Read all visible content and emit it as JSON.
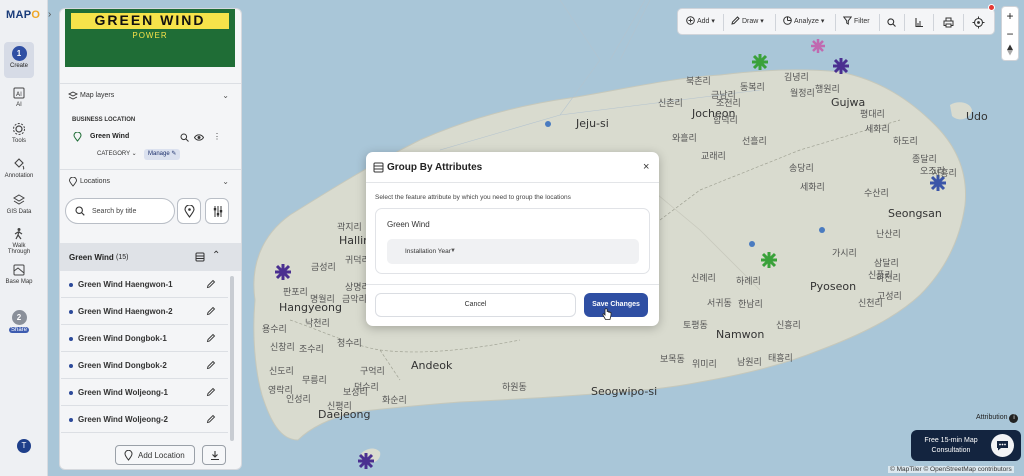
{
  "app": {
    "logo_text": "MAP",
    "logo_accent": "O"
  },
  "rail": {
    "toggle": "›",
    "create": {
      "number": "1",
      "label": "Create"
    },
    "items": [
      "AI",
      "Tools",
      "Annotation",
      "GIS Data",
      "Walk Through",
      "Base Map"
    ],
    "share": {
      "number": "2",
      "label": "Share"
    },
    "avatar": "T"
  },
  "brand": {
    "title": "GREEN WIND",
    "subtitle": "POWER"
  },
  "map_layers": {
    "title": "Map layers",
    "section_label": "BUSINESS LOCATION",
    "layer_name": "Green Wind",
    "category_label": "CATEGORY",
    "manage_label": "Manage"
  },
  "locations": {
    "title": "Locations",
    "search_placeholder": "Search by title",
    "group_name": "Green Wind",
    "group_count": "(15)",
    "items": [
      "Green Wind Haengwon-1",
      "Green Wind Haengwon-2",
      "Green Wind Dongbok-1",
      "Green Wind Dongbok-2",
      "Green Wind Woljeong-1",
      "Green Wind Woljeong-2"
    ],
    "add_label": "Add Location"
  },
  "toolbar": {
    "add": "Add",
    "draw": "Draw",
    "analyze": "Analyze",
    "filter": "Filter"
  },
  "zoom": {
    "in": "+",
    "out": "−"
  },
  "modal": {
    "title": "Group By Attributes",
    "close": "×",
    "description": "Select the feature attribute by which you need to group the locations",
    "layer_name": "Green Wind",
    "selected_attribute": "Installation Year",
    "cancel": "Cancel",
    "save": "Save Changes"
  },
  "consult": {
    "text_line1": "Free 15-min Map",
    "text_line2": "Consultation"
  },
  "attribution": "Attribution",
  "credits": "© MapTiler © OpenStreetMap contributors",
  "map_labels": {
    "jeju_si": "Jeju-si",
    "jocheon": "Jocheon",
    "gujwa": "Gujwa",
    "udo": "Udo",
    "seongsan": "Seongsan",
    "hallim": "Hallim",
    "hangyeong": "Hangyeong",
    "pyoseon": "Pyoseon",
    "namwon": "Namwon",
    "andeok": "Andeok",
    "daejeong": "Daejeong",
    "seogwipo_si": "Seogwipo-si",
    "k1": "김녕리",
    "k2": "신촌리",
    "k3": "조천리",
    "k4": "와흘리",
    "k5": "선흘리",
    "k6": "송당리",
    "k7": "오조리",
    "k8": "난산리",
    "k9": "삼달리",
    "k10": "신풍리",
    "k11": "가시리",
    "k12": "신흥리",
    "k13": "한남리",
    "k14": "남원리",
    "k15": "태흥리",
    "k16": "위미리",
    "k17": "곽지리",
    "k18": "금성리",
    "k19": "귀덕리",
    "k20": "상명리",
    "k21": "금악리",
    "k22": "낙천리",
    "k23": "용수리",
    "k24": "신창리",
    "k25": "조수리",
    "k26": "청수리",
    "k27": "신도리",
    "k28": "무릉리",
    "k29": "구억리",
    "k30": "보성리",
    "k31": "인성리",
    "k32": "영락리",
    "k33": "신평리",
    "k34": "화순리",
    "k35": "서귀동",
    "k36": "하원동",
    "k37": "덕수리",
    "k38": "토평동",
    "k39": "신례리",
    "k40": "판포리",
    "k41": "명월리",
    "k42": "하례리",
    "k43": "세화리",
    "k44": "평대리",
    "k45": "하도리",
    "k46": "종달리",
    "k47": "시흥리",
    "k48": "행원리",
    "k49": "월정리",
    "k50": "동복리",
    "k51": "금남리",
    "k52": "북촌리",
    "k53": "함덕리",
    "k54": "교래리",
    "k55": "수산리",
    "k56": "고성리",
    "k57": "신천리",
    "k58": "하천리",
    "k59": "세화리",
    "k60": "보목동"
  },
  "colors": {
    "accent": "#2f4fa3",
    "brand_green": "#1f6d36",
    "brand_yellow": "#f6e34a",
    "sea": "#a9c6d8",
    "land": "#d6d8cc"
  }
}
